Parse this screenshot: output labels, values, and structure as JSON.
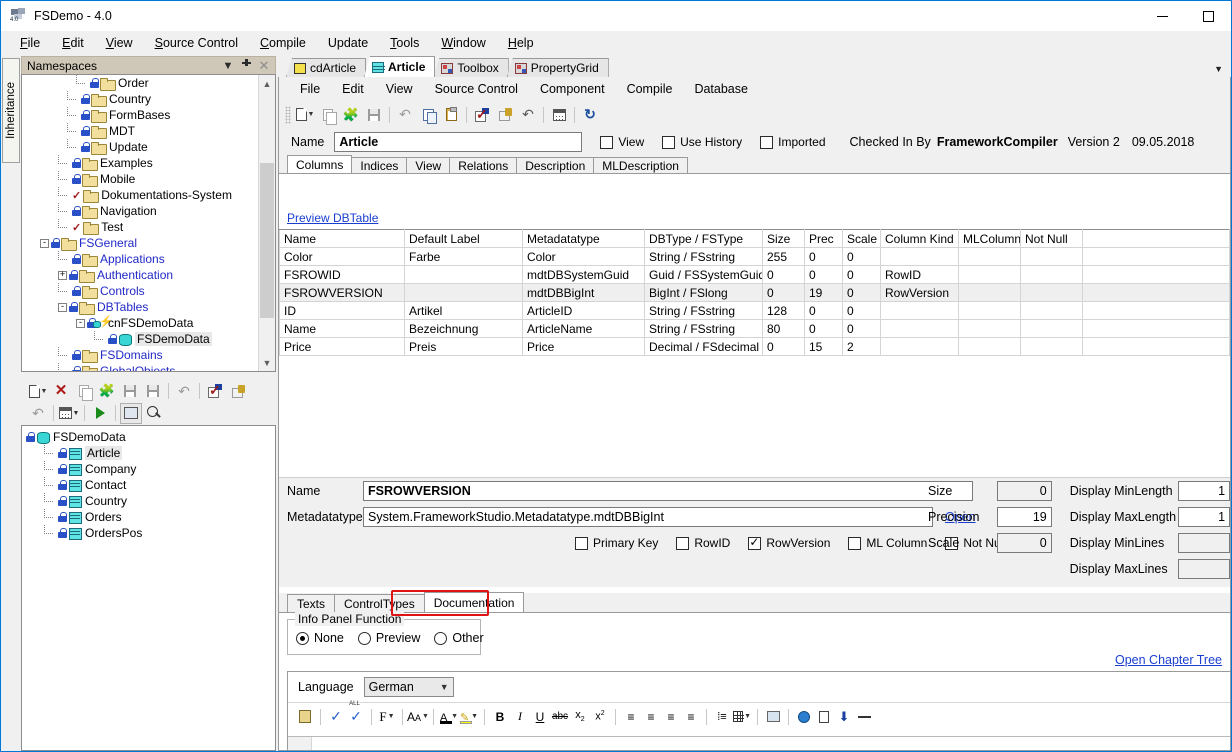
{
  "window": {
    "title": "FSDemo - 4.0",
    "app_icon": "app-icon",
    "version_badge": "4.0",
    "minimize": "minimize",
    "maximize": "maximize"
  },
  "menubar": {
    "items": [
      {
        "label": "File"
      },
      {
        "label": "Edit"
      },
      {
        "label": "View"
      },
      {
        "label": "Source Control"
      },
      {
        "label": "Compile"
      },
      {
        "label": "Update"
      },
      {
        "label": "Tools"
      },
      {
        "label": "Window"
      },
      {
        "label": "Help"
      }
    ]
  },
  "left_dock": {
    "vertical_tab": "Inheritance",
    "panel_title": "Namespaces",
    "tree_items": [
      {
        "label": "Order",
        "indent": 6,
        "icon": "folder",
        "lock": true,
        "expander": "",
        "color": "black"
      },
      {
        "label": "Country",
        "indent": 5,
        "icon": "folder",
        "lock": true,
        "expander": "",
        "color": "black"
      },
      {
        "label": "FormBases",
        "indent": 5,
        "icon": "folder",
        "lock": true,
        "expander": "",
        "color": "black"
      },
      {
        "label": "MDT",
        "indent": 5,
        "icon": "folder",
        "lock": true,
        "expander": "",
        "color": "black"
      },
      {
        "label": "Update",
        "indent": 5,
        "icon": "folder",
        "lock": true,
        "expander": "",
        "color": "black"
      },
      {
        "label": "Examples",
        "indent": 4,
        "icon": "folder",
        "lock": true,
        "expander": "",
        "color": "black"
      },
      {
        "label": "Mobile",
        "indent": 4,
        "icon": "folder",
        "lock": true,
        "expander": "",
        "color": "black"
      },
      {
        "label": "Dokumentations-System",
        "indent": 4,
        "icon": "folder",
        "lock": false,
        "check": true,
        "expander": "",
        "color": "black"
      },
      {
        "label": "Navigation",
        "indent": 4,
        "icon": "folder",
        "lock": true,
        "expander": "",
        "color": "black"
      },
      {
        "label": "Test",
        "indent": 4,
        "icon": "folder",
        "lock": false,
        "check": true,
        "expander": "",
        "color": "black"
      },
      {
        "label": "FSGeneral",
        "indent": 2,
        "icon": "folder",
        "lock": true,
        "expander": "-",
        "color": "blue"
      },
      {
        "label": "Applications",
        "indent": 4,
        "icon": "folder",
        "lock": true,
        "expander": "",
        "color": "blue"
      },
      {
        "label": "Authentication",
        "indent": 4,
        "icon": "folder",
        "lock": true,
        "expander": "+",
        "color": "blue"
      },
      {
        "label": "Controls",
        "indent": 4,
        "icon": "folder",
        "lock": true,
        "expander": "",
        "color": "blue"
      },
      {
        "label": "DBTables",
        "indent": 4,
        "icon": "folder",
        "lock": true,
        "expander": "-",
        "color": "blue"
      },
      {
        "label": "cnFSDemoData",
        "indent": 6,
        "icon": "connection",
        "lock": false,
        "expander": "-",
        "color": "black"
      },
      {
        "label": "FSDemoData",
        "indent": 8,
        "icon": "database",
        "lock": true,
        "expander": "",
        "color": "black",
        "selected": true
      },
      {
        "label": "FSDomains",
        "indent": 4,
        "icon": "folder",
        "lock": true,
        "expander": "",
        "color": "blue"
      },
      {
        "label": "GlobalObjects",
        "indent": 4,
        "icon": "folder",
        "lock": true,
        "expander": "",
        "color": "blue"
      }
    ],
    "toolbar_row1": [
      {
        "icon": "new-document-icon",
        "dropdown": true
      },
      {
        "icon": "delete-icon"
      },
      {
        "icon": "copy-icon"
      },
      {
        "icon": "plugin-icon"
      },
      {
        "icon": "save-icon"
      },
      {
        "icon": "save-all-icon"
      },
      {
        "icon": "undo-icon"
      },
      {
        "icon": "check-in-icon"
      },
      {
        "icon": "check-out-icon"
      }
    ],
    "toolbar_row2": [
      {
        "icon": "undo-arrow-icon"
      },
      {
        "icon": "calendar-icon",
        "dropdown": true
      },
      {
        "icon": "run-icon"
      },
      {
        "icon": "preview-icon"
      },
      {
        "icon": "search-icon"
      }
    ],
    "db_tree": [
      {
        "label": "FSDemoData",
        "indent": 0,
        "icon": "database",
        "lock": true
      },
      {
        "label": "Article",
        "indent": 2,
        "icon": "table",
        "lock": true,
        "selected": true
      },
      {
        "label": "Company",
        "indent": 2,
        "icon": "table",
        "lock": true
      },
      {
        "label": "Contact",
        "indent": 2,
        "icon": "table",
        "lock": true
      },
      {
        "label": "Country",
        "indent": 2,
        "icon": "table",
        "lock": true
      },
      {
        "label": "Orders",
        "indent": 2,
        "icon": "table",
        "lock": true
      },
      {
        "label": "OrdersPos",
        "indent": 2,
        "icon": "table",
        "lock": true
      }
    ]
  },
  "document_tabs": [
    {
      "label": "cdArticle",
      "icon": "class-diagram-icon",
      "active": false
    },
    {
      "label": "Article",
      "icon": "dbtable-icon",
      "active": true
    },
    {
      "label": "Toolbox",
      "icon": "toolbox-icon",
      "active": false
    },
    {
      "label": "PropertyGrid",
      "icon": "propertygrid-icon",
      "active": false
    }
  ],
  "editor": {
    "submenu": [
      {
        "label": "File"
      },
      {
        "label": "Edit"
      },
      {
        "label": "View"
      },
      {
        "label": "Source Control"
      },
      {
        "label": "Component"
      },
      {
        "label": "Compile"
      },
      {
        "label": "Database"
      }
    ],
    "toolbar": [
      {
        "icon": "new-document-icon",
        "dropdown": true
      },
      {
        "icon": "copy-icon"
      },
      {
        "icon": "plugin-icon"
      },
      {
        "icon": "save-icon"
      },
      {
        "icon": "undo-icon"
      },
      {
        "icon": "copy-clipboard-icon"
      },
      {
        "icon": "paste-icon"
      },
      {
        "icon": "check-in-icon"
      },
      {
        "icon": "check-out-icon"
      },
      {
        "icon": "undo-arrow-icon"
      },
      {
        "icon": "calendar-icon"
      },
      {
        "icon": "refresh-icon"
      }
    ],
    "name_label": "Name",
    "name_value": "Article",
    "checkboxes": [
      {
        "label": "View",
        "checked": false
      },
      {
        "label": "Use History",
        "checked": false
      },
      {
        "label": "Imported",
        "checked": false
      }
    ],
    "checked_in_by_label": "Checked In By",
    "checked_in_by_value": "FrameworkCompiler",
    "version": "Version 2",
    "date": "09.05.2018",
    "column_tabs": [
      {
        "label": "Columns",
        "active": true
      },
      {
        "label": "Indices",
        "active": false
      },
      {
        "label": "View",
        "active": false
      },
      {
        "label": "Relations",
        "active": false
      },
      {
        "label": "Description",
        "active": false
      },
      {
        "label": "MLDescription",
        "active": false
      }
    ],
    "preview_link": "Preview DBTable"
  },
  "grid": {
    "columns": [
      "Name",
      "Default Label",
      "Metadatatype",
      "DBType / FSType",
      "Size",
      "Prec",
      "Scale",
      "Column Kind",
      "MLColumn",
      "Not Null"
    ],
    "rows": [
      {
        "cells": [
          "Color",
          "Farbe",
          "Color",
          "String / FSstring",
          "255",
          "0",
          "0",
          "",
          "",
          ""
        ],
        "selected": false
      },
      {
        "cells": [
          "FSROWID",
          "",
          "mdtDBSystemGuid",
          "Guid / FSSystemGuid",
          "0",
          "0",
          "0",
          "RowID",
          "",
          ""
        ],
        "selected": false
      },
      {
        "cells": [
          "FSROWVERSION",
          "",
          "mdtDBBigInt",
          "BigInt / FSlong",
          "0",
          "19",
          "0",
          "RowVersion",
          "",
          ""
        ],
        "selected": true
      },
      {
        "cells": [
          "ID",
          "Artikel",
          "ArticleID",
          "String / FSstring",
          "128",
          "0",
          "0",
          "",
          "",
          ""
        ],
        "selected": false
      },
      {
        "cells": [
          "Name",
          "Bezeichnung",
          "ArticleName",
          "String / FSstring",
          "80",
          "0",
          "0",
          "",
          "",
          ""
        ],
        "selected": false
      },
      {
        "cells": [
          "Price",
          "Preis",
          "Price",
          "Decimal / FSdecimal",
          "0",
          "15",
          "2",
          "",
          "",
          ""
        ],
        "selected": false
      }
    ]
  },
  "detail": {
    "name_label": "Name",
    "name_value": "FSROWVERSION",
    "metadatatype_label": "Metadatatype",
    "metadatatype_value": "System.FrameworkStudio.Metadatatype.mdtDBBigInt",
    "open_link": "Open",
    "size_label": "Size",
    "size_value": "0",
    "precision_label": "Precision",
    "precision_value": "19",
    "scale_label": "Scale",
    "scale_value": "0",
    "display_min_length_label": "Display MinLength",
    "display_min_length_value": "1",
    "display_max_length_label": "Display MaxLength",
    "display_max_length_value": "1",
    "display_min_lines_label": "Display MinLines",
    "display_min_lines_value": "",
    "display_max_lines_label": "Display MaxLines",
    "display_max_lines_value": "",
    "checkboxes": [
      {
        "label": "Primary Key",
        "checked": false
      },
      {
        "label": "RowID",
        "checked": false
      },
      {
        "label": "RowVersion",
        "checked": true
      },
      {
        "label": "ML Column",
        "checked": false
      },
      {
        "label": "Not Null",
        "checked": false
      }
    ]
  },
  "bottom": {
    "tabs": [
      {
        "label": "Texts",
        "active": false
      },
      {
        "label": "ControlTypes",
        "active": false
      },
      {
        "label": "Documentation",
        "active": true,
        "highlighted": true
      }
    ],
    "groupbox_title": "Info Panel Function",
    "radios": [
      {
        "label": "None",
        "selected": true
      },
      {
        "label": "Preview",
        "selected": false
      },
      {
        "label": "Other",
        "selected": false
      }
    ],
    "chapter_link": "Open Chapter Tree",
    "language_label": "Language",
    "language_value": "German",
    "rte_toolbar": [
      {
        "icon": "panel-icon"
      },
      {
        "icon": "spellcheck-icon"
      },
      {
        "icon": "spellcheck-all-icon"
      },
      {
        "icon": "font-icon",
        "dropdown": true
      },
      {
        "icon": "font-size-icon",
        "dropdown": true
      },
      {
        "icon": "text-color-icon",
        "dropdown": true
      },
      {
        "icon": "highlight-color-icon",
        "dropdown": true
      },
      {
        "icon": "bold-icon",
        "glyph": "B"
      },
      {
        "icon": "italic-icon",
        "glyph": "I"
      },
      {
        "icon": "underline-icon",
        "glyph": "U"
      },
      {
        "icon": "strikethrough-icon",
        "glyph": "abc"
      },
      {
        "icon": "subscript-icon"
      },
      {
        "icon": "superscript-icon"
      },
      {
        "icon": "align-left-icon"
      },
      {
        "icon": "align-center-icon"
      },
      {
        "icon": "align-right-icon"
      },
      {
        "icon": "align-justify-icon"
      },
      {
        "icon": "bullet-list-icon"
      },
      {
        "icon": "table-icon",
        "dropdown": true
      },
      {
        "icon": "image-icon"
      },
      {
        "icon": "hyperlink-icon"
      },
      {
        "icon": "insert-page-icon"
      },
      {
        "icon": "anchor-icon"
      },
      {
        "icon": "horizontal-rule-icon"
      }
    ]
  }
}
